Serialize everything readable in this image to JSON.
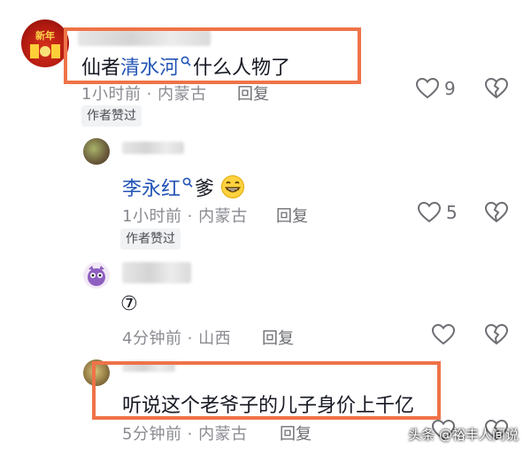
{
  "comments": [
    {
      "text_main": "仙者",
      "text_link": "清水河",
      "text_rest": "什么人物了",
      "time": "1小时前",
      "location": "内蒙古",
      "reply_label": "回复",
      "badge": "作者赞过",
      "likes": "9"
    },
    {
      "text_link": "李永红",
      "text_rest": "爹",
      "time": "1小时前",
      "location": "内蒙古",
      "reply_label": "回复",
      "badge": "作者赞过",
      "likes": "5"
    },
    {
      "text_main": "⑦",
      "time": "4分钟前",
      "location": "山西",
      "reply_label": "回复"
    },
    {
      "text_main": "听说这个老爷子的儿子身价上千亿",
      "time": "5分钟前",
      "location": "内蒙古",
      "reply_label": "回复"
    }
  ],
  "watermark": "头条 @裕丰人间说",
  "colors": {
    "highlight": "#ef7348",
    "link": "#2354b6",
    "meta": "#8a8b91"
  }
}
